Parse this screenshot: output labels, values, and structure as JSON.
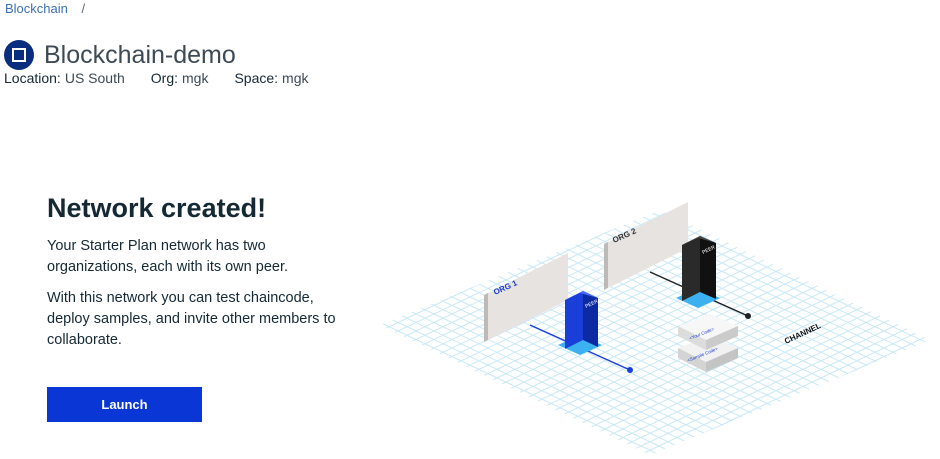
{
  "breadcrumb": {
    "link": "Blockchain",
    "separator": "/"
  },
  "header": {
    "title": "Blockchain-demo",
    "icon": "blockchain-icon"
  },
  "meta": [
    {
      "key": "Location:",
      "value": "US South"
    },
    {
      "key": "Org:",
      "value": "mgk"
    },
    {
      "key": "Space:",
      "value": "mgk"
    }
  ],
  "main": {
    "heading": "Network created!",
    "para1": "Your Starter Plan network has two organizations, each with its own peer.",
    "para2": "With this network you can test chaincode, deploy samples, and invite other members to collaborate.",
    "launch_label": "Launch"
  },
  "illustration": {
    "org1": "ORG 1",
    "org2": "ORG 2",
    "peer": "PEER",
    "your_code": "<Your Code>",
    "sample_code": "<Sample Code>",
    "channel": "CHANNEL",
    "colors": {
      "peer1": "#1a3fd8",
      "peer2": "#1f1f1f",
      "accent": "#3bb1f2",
      "grid": "#c9e8f7"
    }
  }
}
